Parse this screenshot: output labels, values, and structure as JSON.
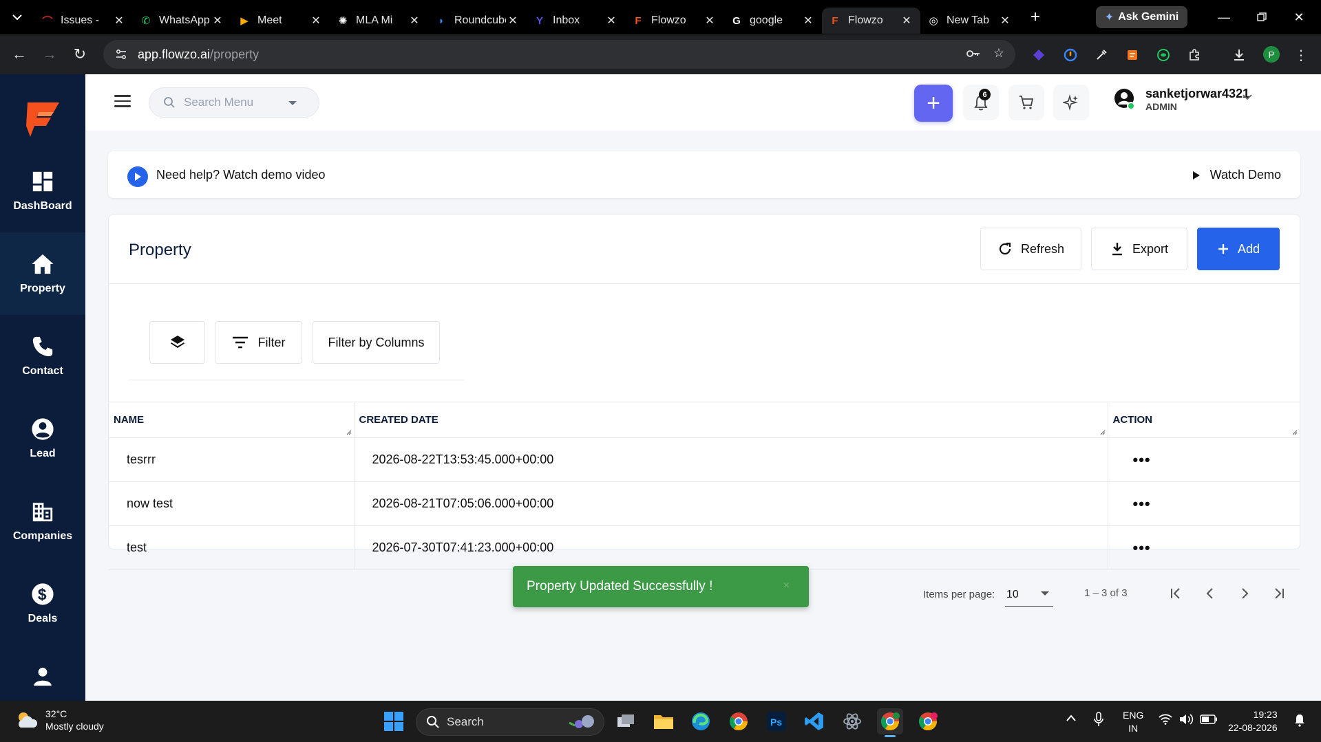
{
  "browser": {
    "tabs": [
      {
        "label": "Issues -",
        "color": "#c62828",
        "glyph": "⌒"
      },
      {
        "label": "WhatsApp",
        "color": "#25d366",
        "glyph": "✆"
      },
      {
        "label": "Meet",
        "color": "#f9ab00",
        "glyph": "▶"
      },
      {
        "label": "MLA Mi",
        "color": "#ffffff",
        "glyph": "✺"
      },
      {
        "label": "Roundcube",
        "color": "#3b82f6",
        "glyph": "◗"
      },
      {
        "label": "Inbox",
        "color": "#5b4fe0",
        "glyph": "Y"
      },
      {
        "label": "Flowzo",
        "color": "#f4511e",
        "glyph": "F"
      },
      {
        "label": "google",
        "color": "#ffffff",
        "glyph": "G"
      },
      {
        "label": "Flowzo",
        "color": "#f4511e",
        "glyph": "F",
        "active": true
      },
      {
        "label": "New Tab",
        "color": "#ffffff",
        "glyph": "◎"
      }
    ],
    "ask_gemini": "Ask Gemini",
    "url_host": "app.flowzo.ai",
    "url_path": "/property",
    "profile_initial": "P"
  },
  "sidebar": {
    "items": [
      {
        "label": "DashBoard",
        "icon": "dashboard-icon"
      },
      {
        "label": "Property",
        "icon": "home-icon",
        "active": true
      },
      {
        "label": "Contact",
        "icon": "phone-icon"
      },
      {
        "label": "Lead",
        "icon": "person-circle-icon"
      },
      {
        "label": "Companies",
        "icon": "building-icon"
      },
      {
        "label": "Deals",
        "icon": "dollar-icon"
      }
    ]
  },
  "topbar": {
    "search_placeholder": "Search Menu",
    "notification_count": "6",
    "user_name": "sanketjorwar4321",
    "user_role": "ADMIN"
  },
  "help": {
    "text": "Need help? Watch demo video",
    "watch_label": "Watch Demo"
  },
  "page": {
    "title": "Property",
    "refresh_label": "Refresh",
    "export_label": "Export",
    "add_label": "Add",
    "filter_label": "Filter",
    "filter_columns_label": "Filter by Columns"
  },
  "table": {
    "columns": [
      "NAME",
      "CREATED DATE",
      "ACTION"
    ],
    "rows": [
      {
        "name": "tesrrr",
        "created": "2026-08-22T13:53:45.000+00:00",
        "action": "•••"
      },
      {
        "name": "now test",
        "created": "2026-08-21T07:05:06.000+00:00",
        "action": "•••"
      },
      {
        "name": "test",
        "created": "2026-07-30T07:41:23.000+00:00",
        "action": "•••"
      }
    ]
  },
  "pagination": {
    "items_per_page_label": "Items per page:",
    "items_per_page": "10",
    "range": "1 – 3 of 3"
  },
  "toast": {
    "message": "Property Updated Successfully !",
    "close": "×"
  },
  "taskbar": {
    "temperature": "32°C",
    "weather": "Mostly cloudy",
    "search_label": "Search",
    "lang_1": "ENG",
    "lang_2": "IN",
    "time": "19:23",
    "date": "22-08-2026"
  }
}
